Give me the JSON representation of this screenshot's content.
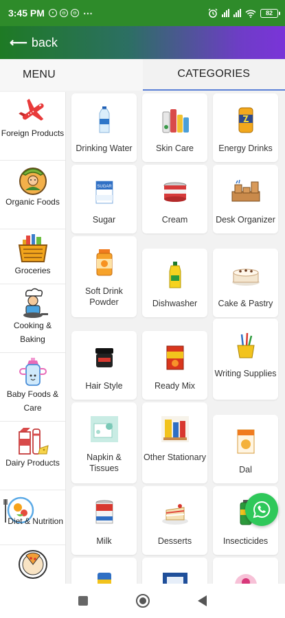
{
  "status_bar": {
    "time": "3:45 PM",
    "more": "⋯",
    "battery": "82"
  },
  "header": {
    "back_label": "back"
  },
  "tabs": {
    "menu": "MENU",
    "categories": "CATEGORIES"
  },
  "menu_items": [
    {
      "label": "Foreign Products",
      "icon": "airplane-icon"
    },
    {
      "label": "Organic Foods",
      "icon": "organic-farmer-icon"
    },
    {
      "label": "Groceries",
      "icon": "grocery-basket-icon"
    },
    {
      "label": "Cooking & Baking",
      "icon": "chef-icon"
    },
    {
      "label": "Baby Foods & Care",
      "icon": "baby-bottle-icon"
    },
    {
      "label": "Dairy Products",
      "icon": "dairy-icon"
    },
    {
      "label": "Diet & Nutrition",
      "icon": "healthy-food-icon"
    },
    {
      "label": "",
      "icon": "pizza-plate-icon"
    }
  ],
  "categories": [
    {
      "label": "Drinking Water",
      "icon": "water-bottle-icon"
    },
    {
      "label": "Skin Care",
      "icon": "skincare-products-icon"
    },
    {
      "label": "Energy Drinks",
      "icon": "energy-drink-can-icon"
    },
    {
      "label": "Sugar",
      "icon": "sugar-pack-icon"
    },
    {
      "label": "Cream",
      "icon": "cream-can-icon"
    },
    {
      "label": "Desk Organizer",
      "icon": "desk-organizer-icon"
    },
    {
      "label": "Soft Drink Powder",
      "icon": "drink-powder-jar-icon"
    },
    {
      "label": "Dishwasher",
      "icon": "dishwasher-liquid-icon"
    },
    {
      "label": "Cake & Pastry",
      "icon": "cake-icon"
    },
    {
      "label": "Hair Style",
      "icon": "hair-wax-jar-icon"
    },
    {
      "label": "Ready Mix",
      "icon": "ready-mix-pack-icon"
    },
    {
      "label": "Writing Supplies",
      "icon": "pen-holder-icon"
    },
    {
      "label": "Napkin & Tissues",
      "icon": "napkin-icon"
    },
    {
      "label": "Other Stationary",
      "icon": "stationery-icon"
    },
    {
      "label": "Dal",
      "icon": "dal-pack-icon"
    },
    {
      "label": "Milk",
      "icon": "milk-can-icon"
    },
    {
      "label": "Desserts",
      "icon": "dessert-icon"
    },
    {
      "label": "Insecticides",
      "icon": "insecticide-can-icon"
    },
    {
      "label": "",
      "icon": "product-icon"
    },
    {
      "label": "",
      "icon": "product-icon"
    },
    {
      "label": "",
      "icon": "product-icon"
    }
  ]
}
